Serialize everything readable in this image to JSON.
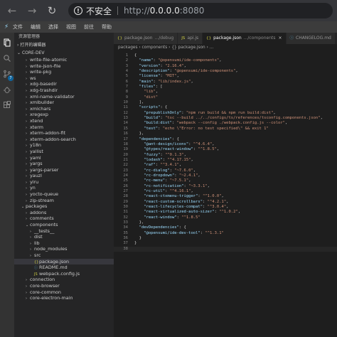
{
  "browser": {
    "back": "←",
    "forward": "→",
    "reload": "↻",
    "warning": "!",
    "security_text": "不安全",
    "url_scheme": "http://",
    "url_host": "0.0.0.0",
    "url_port": ":8080"
  },
  "menu": {
    "logo": "⚡",
    "items": [
      "文件",
      "编辑",
      "选择",
      "视图",
      "前往",
      "帮助"
    ]
  },
  "sidebar": {
    "title": "资源管理器",
    "open_editors": "打开的编辑器",
    "root": "CORE-DEV",
    "rows": [
      {
        "indent": 2,
        "chev": "›",
        "label": "write-file-atomic"
      },
      {
        "indent": 2,
        "chev": "›",
        "label": "write-json-file"
      },
      {
        "indent": 2,
        "chev": "›",
        "label": "write-pkg"
      },
      {
        "indent": 2,
        "chev": "›",
        "label": "ws"
      },
      {
        "indent": 2,
        "chev": "›",
        "label": "xdg-basedir"
      },
      {
        "indent": 2,
        "chev": "›",
        "label": "xdg-trashdir"
      },
      {
        "indent": 2,
        "chev": "›",
        "label": "xml-name-validator"
      },
      {
        "indent": 2,
        "chev": "›",
        "label": "xmlbuilder"
      },
      {
        "indent": 2,
        "chev": "›",
        "label": "xmlchars"
      },
      {
        "indent": 2,
        "chev": "›",
        "label": "xregexp"
      },
      {
        "indent": 2,
        "chev": "›",
        "label": "xtend"
      },
      {
        "indent": 2,
        "chev": "›",
        "label": "xterm"
      },
      {
        "indent": 2,
        "chev": "›",
        "label": "xterm-addon-fit"
      },
      {
        "indent": 2,
        "chev": "›",
        "label": "xterm-addon-search"
      },
      {
        "indent": 2,
        "chev": "›",
        "label": "y18n"
      },
      {
        "indent": 2,
        "chev": "›",
        "label": "yallist"
      },
      {
        "indent": 2,
        "chev": "›",
        "label": "yaml"
      },
      {
        "indent": 2,
        "chev": "›",
        "label": "yargs"
      },
      {
        "indent": 2,
        "chev": "›",
        "label": "yargs-parser"
      },
      {
        "indent": 2,
        "chev": "›",
        "label": "yauzl"
      },
      {
        "indent": 2,
        "chev": "›",
        "label": "yiru"
      },
      {
        "indent": 2,
        "chev": "›",
        "label": "yn"
      },
      {
        "indent": 2,
        "chev": "›",
        "label": "yocto-queue"
      },
      {
        "indent": 2,
        "chev": "›",
        "label": "zip-stream"
      },
      {
        "indent": 1,
        "chev": "⌄",
        "label": "packages"
      },
      {
        "indent": 2,
        "chev": "›",
        "label": "addons"
      },
      {
        "indent": 2,
        "chev": "›",
        "label": "comments"
      },
      {
        "indent": 2,
        "chev": "⌄",
        "label": "components"
      },
      {
        "indent": 3,
        "chev": "›",
        "label": "__tests__"
      },
      {
        "indent": 3,
        "chev": "›",
        "label": "dist"
      },
      {
        "indent": 3,
        "chev": "›",
        "label": "lib"
      },
      {
        "indent": 3,
        "chev": "›",
        "label": "node_modules"
      },
      {
        "indent": 3,
        "chev": "›",
        "label": "src"
      },
      {
        "indent": 3,
        "chev": "",
        "icon": "{}",
        "icon_type": "json",
        "label": "package.json",
        "selected": true
      },
      {
        "indent": 3,
        "chev": "",
        "icon": "ⓘ",
        "icon_type": "md",
        "label": "README.md"
      },
      {
        "indent": 3,
        "chev": "",
        "icon": "JS",
        "icon_type": "js",
        "label": "webpack.config.js"
      },
      {
        "indent": 2,
        "chev": "›",
        "label": "connection"
      },
      {
        "indent": 2,
        "chev": "›",
        "label": "core-browser"
      },
      {
        "indent": 2,
        "chev": "›",
        "label": "core-common"
      },
      {
        "indent": 2,
        "chev": "›",
        "label": "core-electron-main"
      }
    ]
  },
  "tabs": [
    {
      "icon": "{}",
      "type": "json",
      "label": "package.json",
      "path": ".../debug",
      "active": false
    },
    {
      "icon": "JS",
      "type": "js",
      "label": "api.js",
      "path": "",
      "active": false
    },
    {
      "icon": "{}",
      "type": "json",
      "label": "package.json",
      "path": ".../components",
      "active": true
    },
    {
      "icon": "ⓘ",
      "type": "md",
      "label": "CHANGELOG.md",
      "path": "",
      "active": false
    }
  ],
  "breadcrumbs": "packages  ›  components  ›  {} package.json  ›  ...",
  "code": [
    [
      [
        "pun",
        "{"
      ]
    ],
    [
      [
        "pun",
        "  "
      ],
      [
        "key",
        "\"name\""
      ],
      [
        "pun",
        ": "
      ],
      [
        "str",
        "\"@opensumi/ide-components\""
      ],
      [
        "pun",
        ","
      ]
    ],
    [
      [
        "pun",
        "  "
      ],
      [
        "key",
        "\"version\""
      ],
      [
        "pun",
        ": "
      ],
      [
        "str",
        "\"2.16.4\""
      ],
      [
        "pun",
        ","
      ]
    ],
    [
      [
        "pun",
        "  "
      ],
      [
        "key",
        "\"description\""
      ],
      [
        "pun",
        ": "
      ],
      [
        "str",
        "\"@opensumi/ide-components\""
      ],
      [
        "pun",
        ","
      ]
    ],
    [
      [
        "pun",
        "  "
      ],
      [
        "key",
        "\"license\""
      ],
      [
        "pun",
        ": "
      ],
      [
        "str",
        "\"MIT\""
      ],
      [
        "pun",
        ","
      ]
    ],
    [
      [
        "pun",
        "  "
      ],
      [
        "key",
        "\"main\""
      ],
      [
        "pun",
        ": "
      ],
      [
        "str",
        "\"lib/index.js\""
      ],
      [
        "pun",
        ","
      ]
    ],
    [
      [
        "pun",
        "  "
      ],
      [
        "key",
        "\"files\""
      ],
      [
        "pun",
        ": ["
      ]
    ],
    [
      [
        "pun",
        "    "
      ],
      [
        "str",
        "\"lib\""
      ],
      [
        "pun",
        ","
      ]
    ],
    [
      [
        "pun",
        "    "
      ],
      [
        "str",
        "\"dist\""
      ]
    ],
    [
      [
        "pun",
        "  ],"
      ]
    ],
    [
      [
        "pun",
        "  "
      ],
      [
        "key",
        "\"scripts\""
      ],
      [
        "pun",
        ": {"
      ]
    ],
    [
      [
        "pun",
        "    "
      ],
      [
        "key",
        "\"prepublishOnly\""
      ],
      [
        "pun",
        ": "
      ],
      [
        "str",
        "\"npm run build && npm run build:dist\""
      ],
      [
        "pun",
        ","
      ]
    ],
    [
      [
        "pun",
        "    "
      ],
      [
        "key",
        "\"build\""
      ],
      [
        "pun",
        ": "
      ],
      [
        "str",
        "\"tsc --build ../../configs/ts/references/tsconfig.components.json\""
      ],
      [
        "pun",
        ","
      ]
    ],
    [
      [
        "pun",
        "    "
      ],
      [
        "key",
        "\"build:dist\""
      ],
      [
        "pun",
        ": "
      ],
      [
        "str",
        "\"webpack --config ./webpack.config.js --color\""
      ],
      [
        "pun",
        ","
      ]
    ],
    [
      [
        "pun",
        "    "
      ],
      [
        "key",
        "\"test\""
      ],
      [
        "pun",
        ": "
      ],
      [
        "str",
        "\"echo \\\"Error: no test specified\\\" && exit 1\""
      ]
    ],
    [
      [
        "pun",
        "  },"
      ]
    ],
    [
      [
        "pun",
        "  "
      ],
      [
        "key",
        "\"dependencies\""
      ],
      [
        "pun",
        ": {"
      ]
    ],
    [
      [
        "pun",
        "    "
      ],
      [
        "key",
        "\"@ant-design/icons\""
      ],
      [
        "pun",
        ": "
      ],
      [
        "str",
        "\"^4.6.4\""
      ],
      [
        "pun",
        ","
      ]
    ],
    [
      [
        "pun",
        "    "
      ],
      [
        "key",
        "\"@types/react-window\""
      ],
      [
        "pun",
        ": "
      ],
      [
        "str",
        "\"^1.8.5\""
      ],
      [
        "pun",
        ","
      ]
    ],
    [
      [
        "pun",
        "    "
      ],
      [
        "key",
        "\"fuzzy\""
      ],
      [
        "pun",
        ": "
      ],
      [
        "str",
        "\"^0.1.3\""
      ],
      [
        "pun",
        ","
      ]
    ],
    [
      [
        "pun",
        "    "
      ],
      [
        "key",
        "\"lodash\""
      ],
      [
        "pun",
        ": "
      ],
      [
        "str",
        "\"^4.17.15\""
      ],
      [
        "pun",
        ","
      ]
    ],
    [
      [
        "pun",
        "    "
      ],
      [
        "key",
        "\"raf\""
      ],
      [
        "pun",
        ": "
      ],
      [
        "str",
        "\"^3.4.1\""
      ],
      [
        "pun",
        ","
      ]
    ],
    [
      [
        "pun",
        "    "
      ],
      [
        "key",
        "\"rc-dialog\""
      ],
      [
        "pun",
        ": "
      ],
      [
        "str",
        "\"~7.6.0\""
      ],
      [
        "pun",
        ","
      ]
    ],
    [
      [
        "pun",
        "    "
      ],
      [
        "key",
        "\"rc-dropdown\""
      ],
      [
        "pun",
        ": "
      ],
      [
        "str",
        "\"~2.4.1\""
      ],
      [
        "pun",
        ","
      ]
    ],
    [
      [
        "pun",
        "    "
      ],
      [
        "key",
        "\"rc-menu\""
      ],
      [
        "pun",
        ": "
      ],
      [
        "str",
        "\"~7.5.1\""
      ],
      [
        "pun",
        ","
      ]
    ],
    [
      [
        "pun",
        "    "
      ],
      [
        "key",
        "\"rc-notification\""
      ],
      [
        "pun",
        ": "
      ],
      [
        "str",
        "\"~3.3.1\""
      ],
      [
        "pun",
        ","
      ]
    ],
    [
      [
        "pun",
        "    "
      ],
      [
        "key",
        "\"rc-util\""
      ],
      [
        "pun",
        ": "
      ],
      [
        "str",
        "\"^4.16.1\""
      ],
      [
        "pun",
        ","
      ]
    ],
    [
      [
        "pun",
        "    "
      ],
      [
        "key",
        "\"react-ctxmenu-trigger\""
      ],
      [
        "pun",
        ": "
      ],
      [
        "str",
        "\"^1.0.0\""
      ],
      [
        "pun",
        ","
      ]
    ],
    [
      [
        "pun",
        "    "
      ],
      [
        "key",
        "\"react-custom-scrollbars\""
      ],
      [
        "pun",
        ": "
      ],
      [
        "str",
        "\"^4.2.1\""
      ],
      [
        "pun",
        ","
      ]
    ],
    [
      [
        "pun",
        "    "
      ],
      [
        "key",
        "\"react-lifecycles-compat\""
      ],
      [
        "pun",
        ": "
      ],
      [
        "str",
        "\"^3.0.4\""
      ],
      [
        "pun",
        ","
      ]
    ],
    [
      [
        "pun",
        "    "
      ],
      [
        "key",
        "\"react-virtualized-auto-sizer\""
      ],
      [
        "pun",
        ": "
      ],
      [
        "str",
        "\"^1.0.2\""
      ],
      [
        "pun",
        ","
      ]
    ],
    [
      [
        "pun",
        "    "
      ],
      [
        "key",
        "\"react-window\""
      ],
      [
        "pun",
        ": "
      ],
      [
        "str",
        "\"^1.8.5\""
      ]
    ],
    [
      [
        "pun",
        "  },"
      ]
    ],
    [
      [
        "pun",
        "  "
      ],
      [
        "key",
        "\"devDependencies\""
      ],
      [
        "pun",
        ": {"
      ]
    ],
    [
      [
        "pun",
        "    "
      ],
      [
        "key",
        "\"@opensumi/ide-dev-tool\""
      ],
      [
        "pun",
        ": "
      ],
      [
        "str",
        "\"^1.3.1\""
      ]
    ],
    [
      [
        "pun",
        "  }"
      ]
    ],
    [
      [
        "pun",
        "}"
      ]
    ],
    [
      [
        "pun",
        ""
      ]
    ]
  ],
  "activity_badge": "7"
}
